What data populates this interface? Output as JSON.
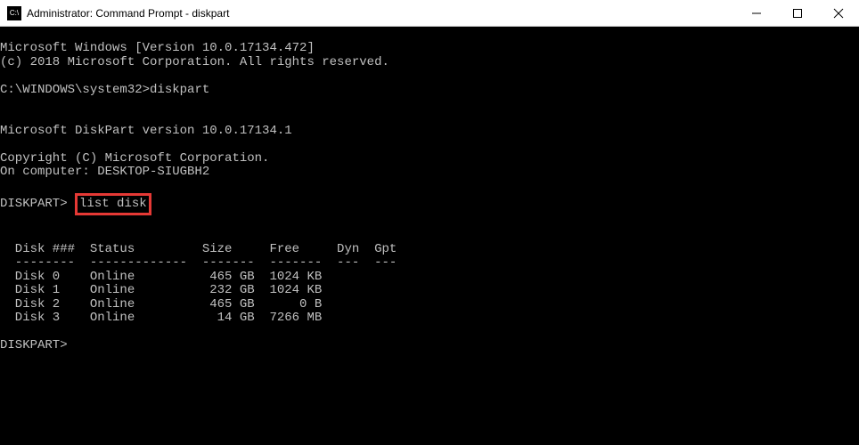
{
  "window": {
    "title": "Administrator: Command Prompt - diskpart",
    "icon_label": "C:\\"
  },
  "terminal": {
    "version_line": "Microsoft Windows [Version 10.0.17134.472]",
    "copyright_line": "(c) 2018 Microsoft Corporation. All rights reserved.",
    "prompt1_path": "C:\\WINDOWS\\system32>",
    "prompt1_cmd": "diskpart",
    "diskpart_version": "Microsoft DiskPart version 10.0.17134.1",
    "diskpart_copyright": "Copyright (C) Microsoft Corporation.",
    "computer_line": "On computer: DESKTOP-SIUGBH2",
    "diskpart_prompt": "DISKPART>",
    "list_cmd": "list disk",
    "table": {
      "header": "  Disk ###  Status         Size     Free     Dyn  Gpt",
      "divider": "  --------  -------------  -------  -------  ---  ---",
      "rows": [
        "  Disk 0    Online          465 GB  1024 KB",
        "  Disk 1    Online          232 GB  1024 KB",
        "  Disk 2    Online          465 GB      0 B",
        "  Disk 3    Online           14 GB  7266 MB"
      ]
    },
    "final_prompt": "DISKPART>"
  }
}
